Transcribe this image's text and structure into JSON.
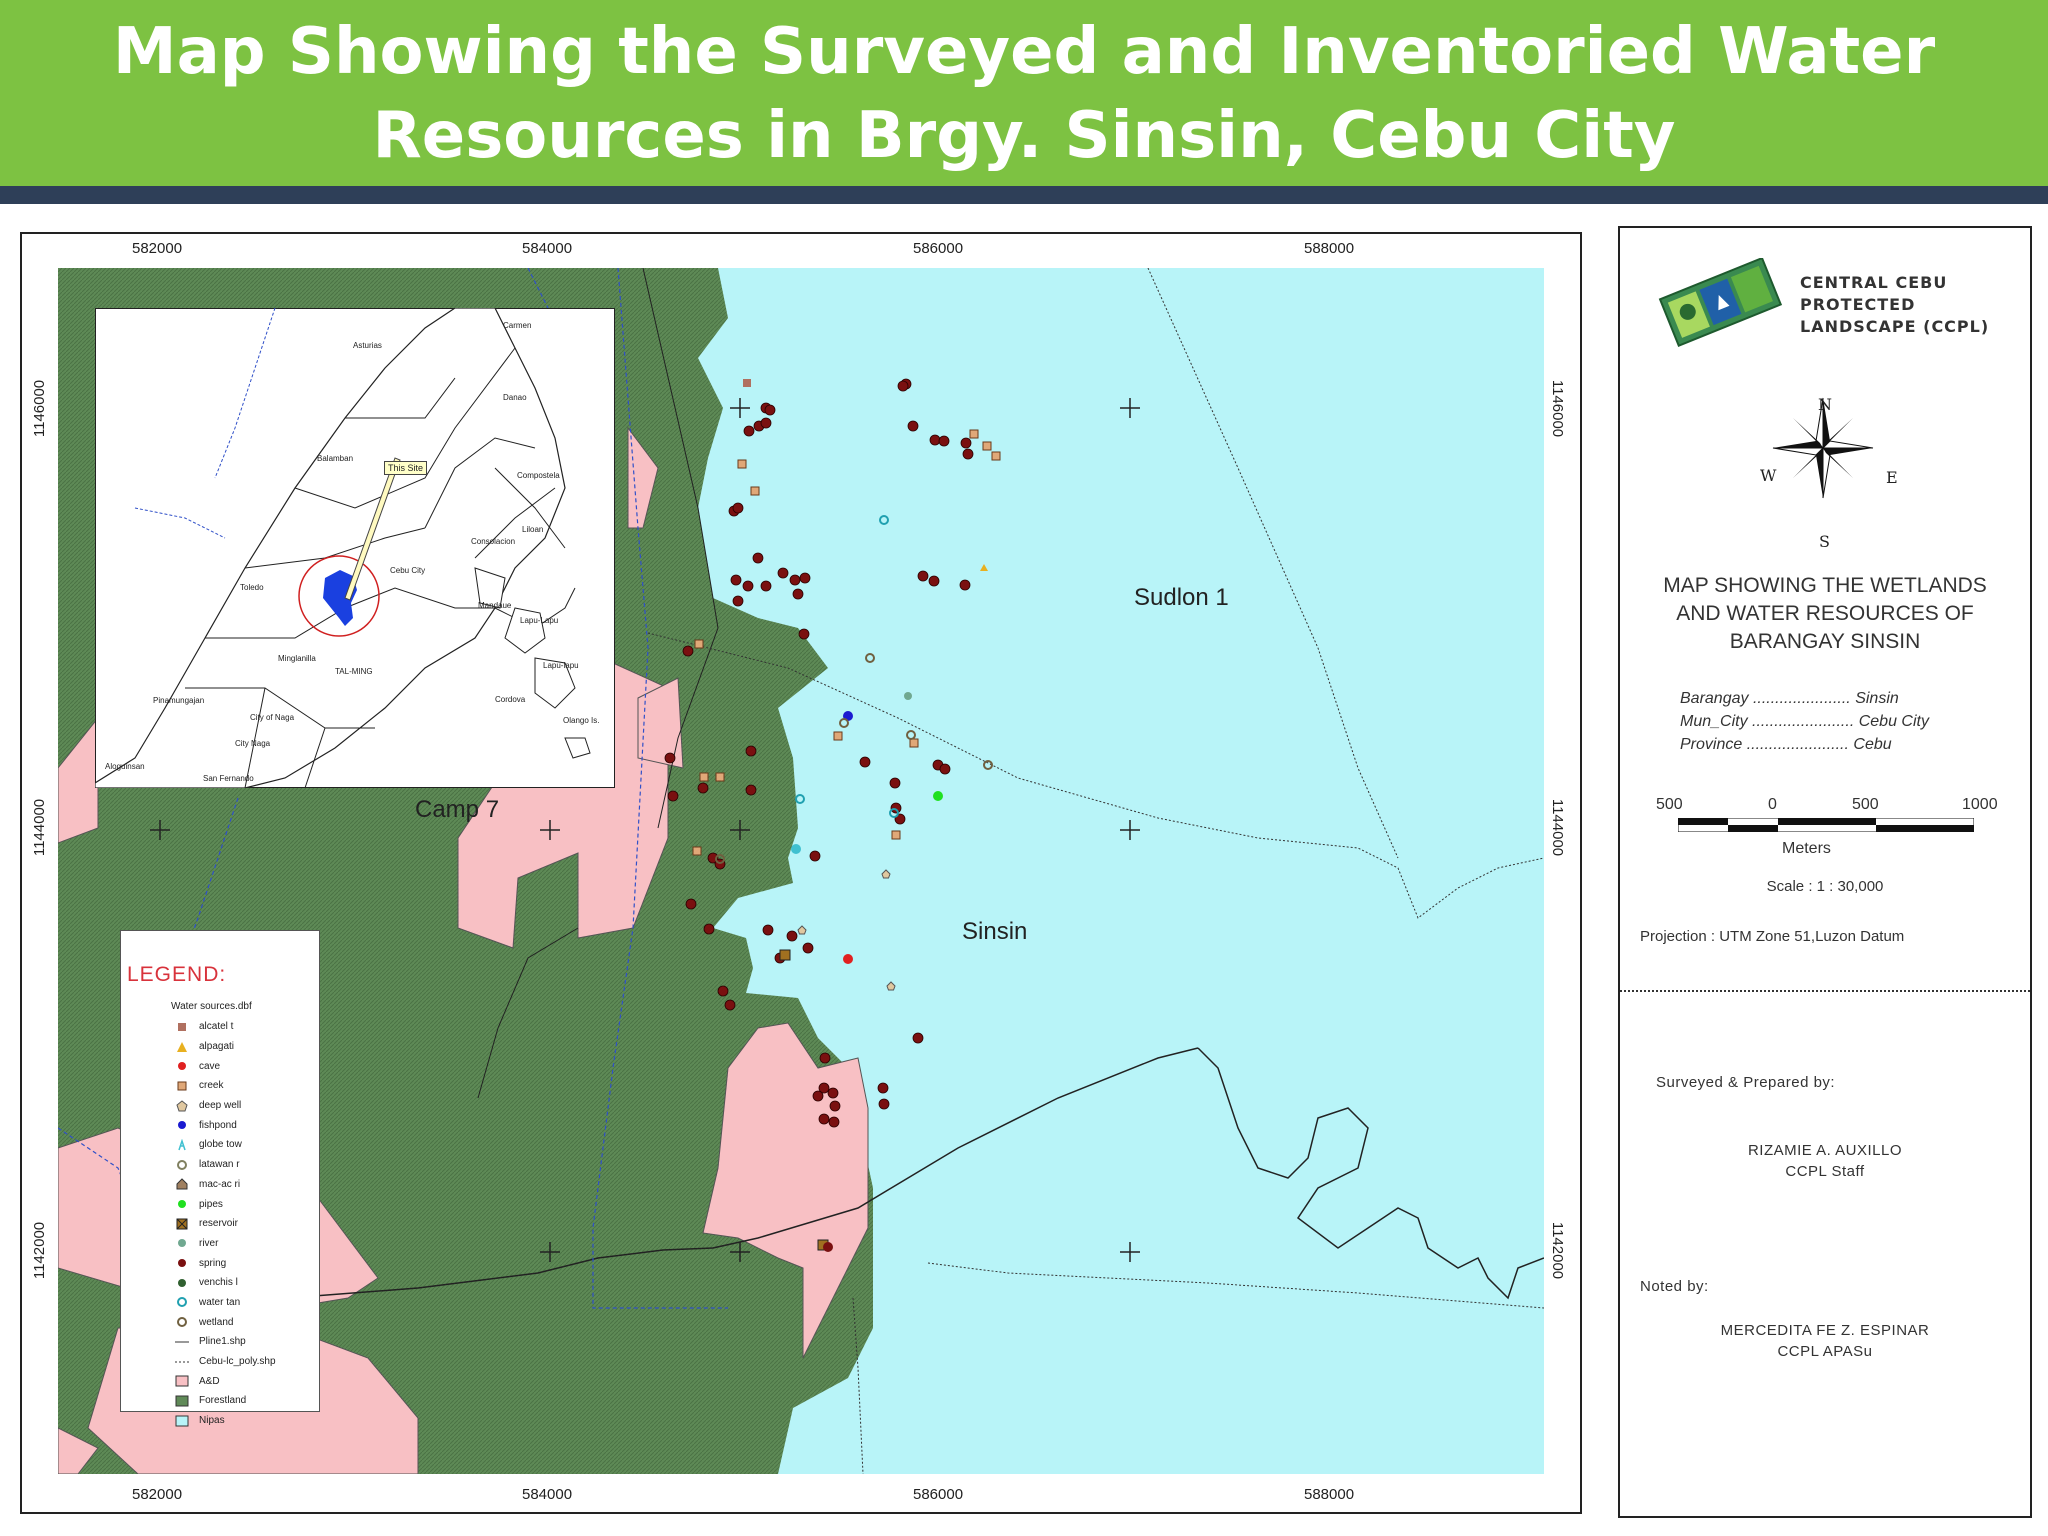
{
  "header": {
    "title_line1": "Map Showing the Surveyed and Inventoried Water",
    "title_line2": "Resources in Brgy. Sinsin, Cebu City"
  },
  "grid": {
    "x_labels": [
      "582000",
      "584000",
      "586000",
      "588000"
    ],
    "y_labels": [
      "1146000",
      "1144000",
      "1142000"
    ]
  },
  "places": {
    "sudlon": "Sudlon 1",
    "sinsin": "Sinsin",
    "camp7": "Camp 7"
  },
  "inset": {
    "site_tag": "This Site",
    "labels": [
      "Carmen",
      "Asturias",
      "Danao",
      "Balamban",
      "Compostela",
      "Liloan",
      "Consolacion",
      "Cebu City",
      "Toledo",
      "Mandaue",
      "Lapu-Lapu",
      "Lapu-lapu",
      "Cordova",
      "Minglanilla",
      "TAL-MING",
      "Pinamungajan",
      "City of Naga",
      "Olango Is.",
      "City Naga",
      "Aloguinsan",
      "San Fernando"
    ]
  },
  "legend": {
    "title": "LEGEND:",
    "subtitle": "Water sources.dbf",
    "items": [
      {
        "label": "alcatel t",
        "symbol": "square",
        "color": "#b07060"
      },
      {
        "label": "alpagati",
        "symbol": "triangle",
        "color": "#e8b020"
      },
      {
        "label": "cave",
        "symbol": "dot",
        "color": "#e02020"
      },
      {
        "label": "creek",
        "symbol": "square-outline",
        "color": "#e0a878"
      },
      {
        "label": "deep well",
        "symbol": "pentagon",
        "color": "#e0c8a0"
      },
      {
        "label": "fishpond",
        "symbol": "dot",
        "color": "#1a1ad0"
      },
      {
        "label": "globe tow",
        "symbol": "tower",
        "color": "#40c0d0"
      },
      {
        "label": "latawan r",
        "symbol": "ring",
        "color": "#808060"
      },
      {
        "label": "mac-ac ri",
        "symbol": "house",
        "color": "#a08060"
      },
      {
        "label": "pipes",
        "symbol": "dot",
        "color": "#20e020"
      },
      {
        "label": "reservoir",
        "symbol": "x-box",
        "color": "#a07020"
      },
      {
        "label": "river",
        "symbol": "dot",
        "color": "#70a890"
      },
      {
        "label": "spring",
        "symbol": "dot",
        "color": "#7a1010"
      },
      {
        "label": "venchis l",
        "symbol": "dot",
        "color": "#306030"
      },
      {
        "label": "water tan",
        "symbol": "ring",
        "color": "#20a0b0"
      },
      {
        "label": "wetland",
        "symbol": "ring",
        "color": "#706040"
      },
      {
        "label": "Pline1.shp",
        "symbol": "line",
        "color": "#333333"
      },
      {
        "label": "Cebu-lc_poly.shp",
        "symbol": "dotline",
        "color": "#333333"
      },
      {
        "label": "A&D",
        "symbol": "fill",
        "color": "#f8c0c4"
      },
      {
        "label": "Forestland",
        "symbol": "fill",
        "color": "#608a58"
      },
      {
        "label": "Nipas",
        "symbol": "fill",
        "color": "#b8f4f8"
      }
    ]
  },
  "panel": {
    "logo_line1": "CENTRAL CEBU",
    "logo_line2": "PROTECTED",
    "logo_line3": "LANDSCAPE (CCPL)",
    "compass": {
      "n": "N",
      "s": "S",
      "e": "E",
      "w": "W"
    },
    "title_line1": "MAP SHOWING THE WETLANDS",
    "title_line2": "AND WATER RESOURCES OF",
    "title_line3": "BARANGAY SINSIN",
    "info": [
      {
        "key": "Barangay ......................",
        "value": "Sinsin"
      },
      {
        "key": "Mun_City .......................",
        "value": "Cebu City"
      },
      {
        "key": "Province .......................",
        "value": "Cebu"
      }
    ],
    "scale_ticks": [
      "500",
      "0",
      "500",
      "1000"
    ],
    "scale_units": "Meters",
    "scale": "Scale : 1 : 30,000",
    "projection": "Projection : UTM Zone 51,Luzon Datum",
    "surveyed_label": "Surveyed & Prepared  by:",
    "surveyor_name": "RIZAMIE A. AUXILLO",
    "surveyor_title": "CCPL Staff",
    "noted_label": "Noted by:",
    "noted_name": "MERCEDITA FE Z. ESPINAR",
    "noted_title": "CCPL APASu"
  },
  "colors": {
    "header": "#7dc242",
    "header_bar": "#2e3f58",
    "nipas": "#b8f4f8",
    "forest": "#608a58",
    "ad": "#f8c0c4"
  }
}
